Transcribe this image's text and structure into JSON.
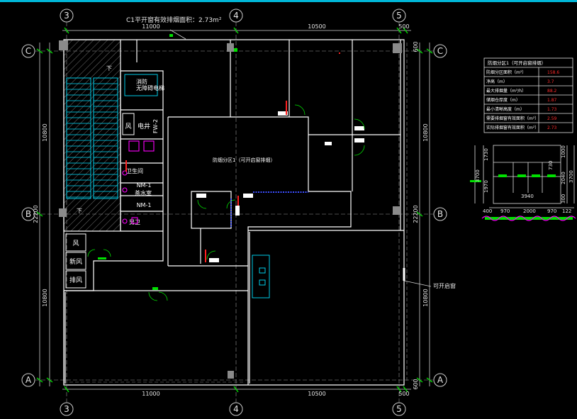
{
  "title_note": "C1平开窗有效排烟面积：2.73m²",
  "side_note": "可开启窗",
  "grid": {
    "columns": [
      "3",
      "4",
      "5"
    ],
    "rows": [
      "C",
      "B",
      "A"
    ]
  },
  "dims": {
    "top": [
      "11000",
      "10500",
      "500"
    ],
    "bottom": [
      "11000",
      "10500",
      "500"
    ],
    "left": [
      "10800",
      "22200",
      "10800"
    ],
    "right": [
      "10800",
      "22200",
      "10800"
    ],
    "right_small": [
      "600",
      "600"
    ]
  },
  "rooms": {
    "elevator": "消防\n无障碍电梯",
    "wind": "风",
    "pipe_well": "电井",
    "fw2": "FW-2",
    "wc": "卫生间",
    "tea": "茶水室",
    "nm1a": "NM-1",
    "nm1b": "NM-1",
    "wc_male": "男卫",
    "shaft_wind": "风",
    "shaft_new": "新风",
    "shaft_exhaust": "排风",
    "office_center": "防烟分区1（可开启窗排烟）",
    "stair_up": "下",
    "stair_down": "下"
  },
  "table": {
    "header": "防烟分区1（可开启窗排烟）",
    "rows": [
      {
        "label": "防烟分区面积（m²）",
        "value": "158.6"
      },
      {
        "label": "净高（m）",
        "value": "3.7"
      },
      {
        "label": "最大排烟量（m³/h）",
        "value": "88.2"
      },
      {
        "label": "储烟仓厚度（m）",
        "value": "1.87"
      },
      {
        "label": "最小清晰高度（m）",
        "value": "1.73"
      },
      {
        "label": "需要排烟窗有效面积（m²）",
        "value": "2.59"
      },
      {
        "label": "实际排烟窗有效面积（m²）",
        "value": "2.73"
      }
    ]
  },
  "elevation": {
    "left": [
      "1730",
      "3700",
      "1970"
    ],
    "right": [
      "1000",
      "730",
      "2040",
      "3700",
      "300"
    ],
    "inner": "3940",
    "bottom": [
      "400",
      "970",
      "2000",
      "970",
      "122"
    ]
  },
  "colors": {
    "wall": "#ffffff",
    "axis": "#00e000",
    "cyan": "#00e0ff",
    "red": "#ff2020",
    "magenta": "#ff00ff",
    "hatch": "#9a9a9a",
    "blue": "#3b4dff",
    "dim": "#d8d8d8"
  }
}
